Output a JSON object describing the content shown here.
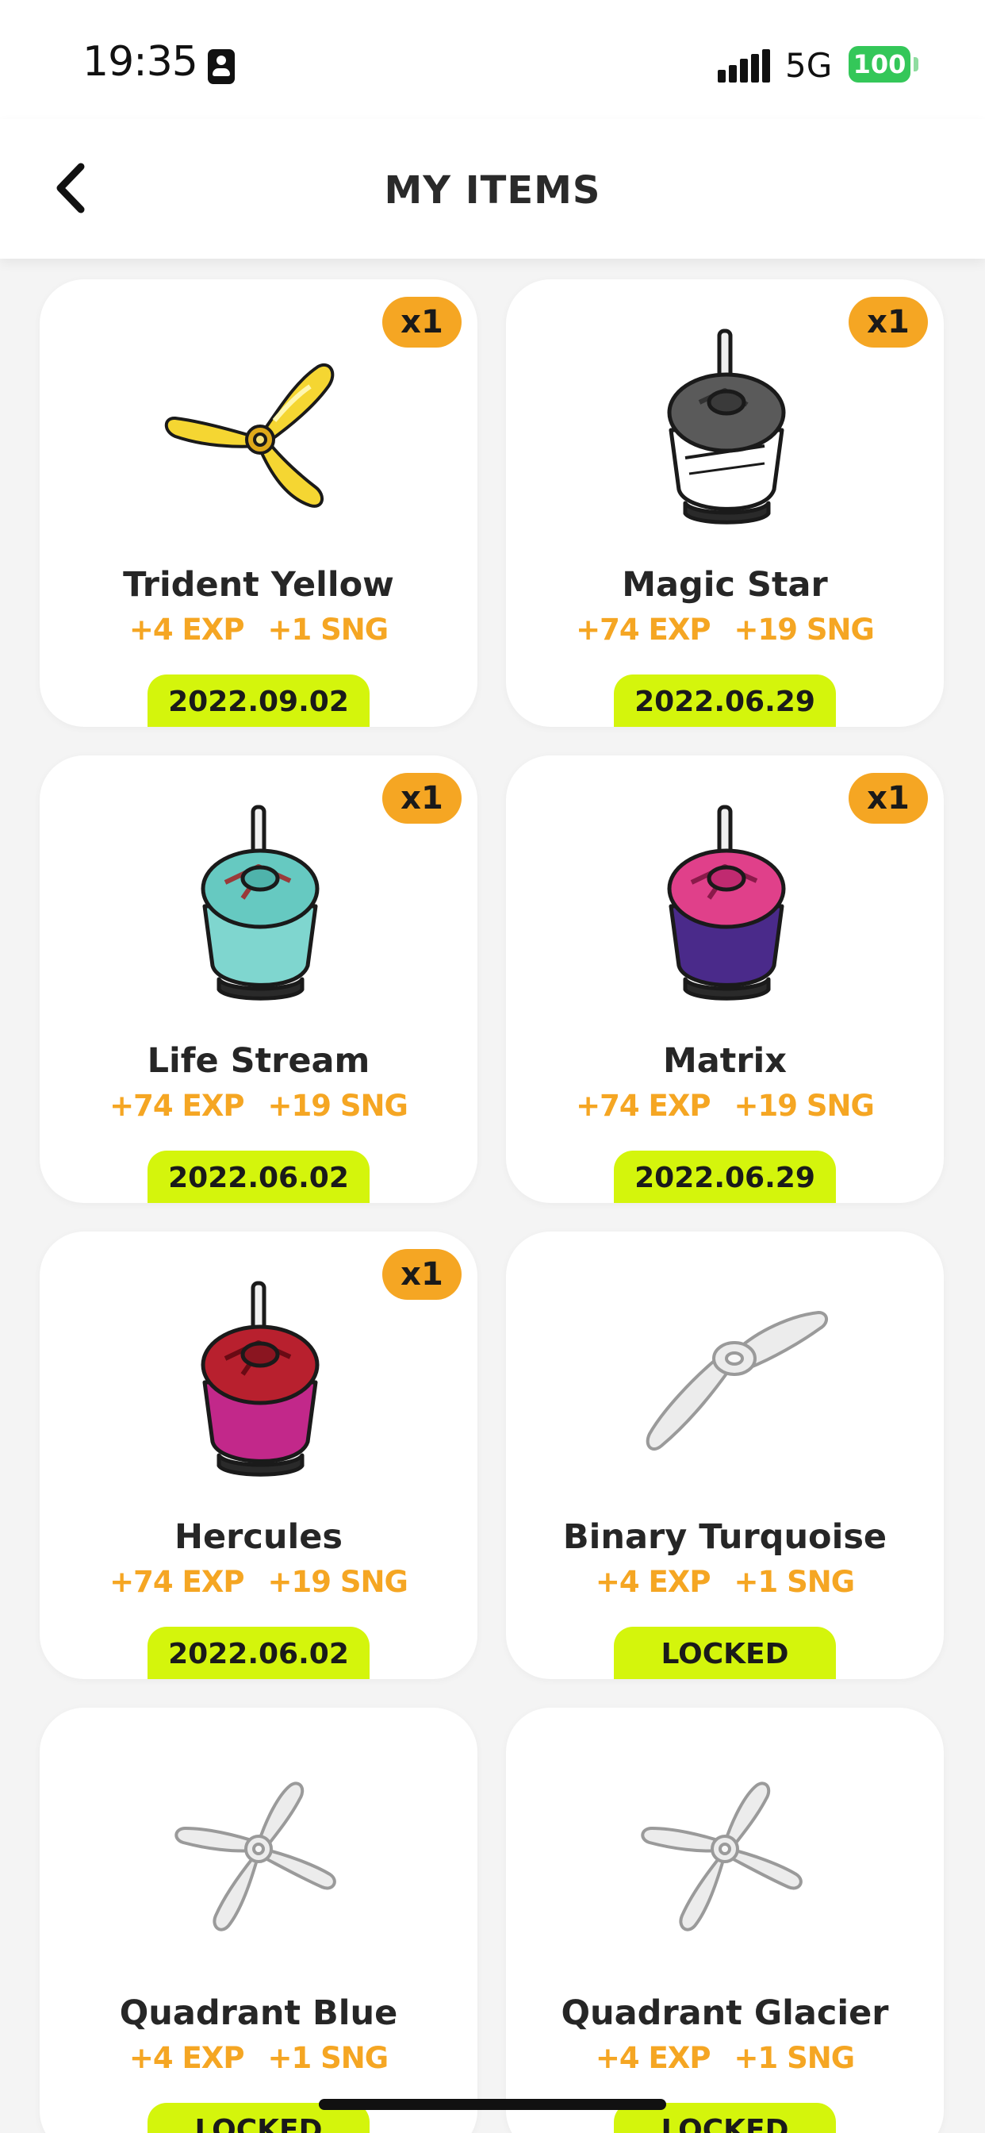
{
  "status_bar": {
    "time": "19:35",
    "network": "5G",
    "battery": "100"
  },
  "header": {
    "title": "MY ITEMS"
  },
  "items": [
    {
      "name": "Trident Yellow",
      "quantity": "x1",
      "exp": "+4 EXP",
      "sng": "+1 SNG",
      "tag": "2022.09.02",
      "icon": "trident-propeller-yellow"
    },
    {
      "name": "Magic Star",
      "quantity": "x1",
      "exp": "+74 EXP",
      "sng": "+19 SNG",
      "tag": "2022.06.29",
      "icon": "motor-black-white"
    },
    {
      "name": "Life Stream",
      "quantity": "x1",
      "exp": "+74 EXP",
      "sng": "+19 SNG",
      "tag": "2022.06.02",
      "icon": "motor-teal"
    },
    {
      "name": "Matrix",
      "quantity": "x1",
      "exp": "+74 EXP",
      "sng": "+19 SNG",
      "tag": "2022.06.29",
      "icon": "motor-purple-pink"
    },
    {
      "name": "Hercules",
      "quantity": "x1",
      "exp": "+74 EXP",
      "sng": "+19 SNG",
      "tag": "2022.06.02",
      "icon": "motor-red-magenta"
    },
    {
      "name": "Binary Turquoise",
      "exp": "+4 EXP",
      "sng": "+1 SNG",
      "tag": "LOCKED",
      "icon": "binary-propeller-locked"
    },
    {
      "name": "Quadrant Blue",
      "exp": "+4 EXP",
      "sng": "+1 SNG",
      "tag": "LOCKED",
      "icon": "quad-propeller-locked"
    },
    {
      "name": "Quadrant Glacier",
      "exp": "+4 EXP",
      "sng": "+1 SNG",
      "tag": "LOCKED",
      "icon": "quad-propeller-locked"
    }
  ],
  "colors": {
    "accent_orange": "#f5a623",
    "tag_lime": "#d4f50c",
    "battery_green": "#34c759"
  }
}
